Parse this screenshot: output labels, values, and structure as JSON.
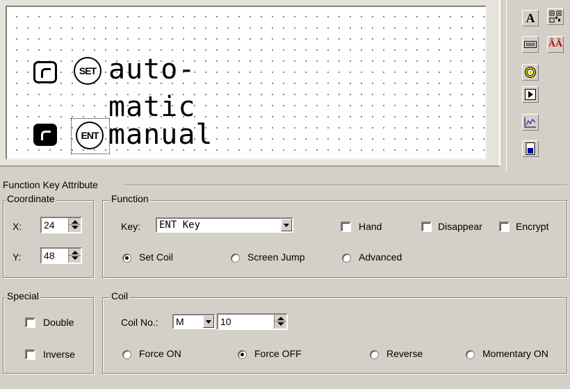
{
  "canvas": {
    "lines": [
      {
        "key_label": "SET",
        "text1": "auto-",
        "text2": "matic"
      },
      {
        "key_label": "ENT",
        "text1": "manual"
      }
    ]
  },
  "toolbox": {
    "icons": [
      "text-tool-icon",
      "qr-tool-icon",
      "bar-tool-icon",
      "font-tool-icon",
      "lamp-tool-icon",
      "play-tool-icon",
      "trend-tool-icon",
      "door-tool-icon"
    ],
    "text_glyph": "A",
    "font_glyph": "ÂÂ"
  },
  "attribute": {
    "title": "Function Key Attribute",
    "coordinate": {
      "title": "Coordinate",
      "x_label": "X:",
      "x_value": "24",
      "y_label": "Y:",
      "y_value": "48"
    },
    "function": {
      "title": "Function",
      "key_label": "Key:",
      "key_value": "ENT Key",
      "hand": "Hand",
      "disappear": "Disappear",
      "encrypt": "Encrypt",
      "set_coil": "Set Coil",
      "screen_jump": "Screen Jump",
      "advanced": "Advanced",
      "selected_mode": "Set Coil"
    },
    "special": {
      "title": "Special",
      "double": "Double",
      "inverse": "Inverse"
    },
    "coil": {
      "title": "Coil",
      "coil_no_label": "Coil No.:",
      "coil_type": "M",
      "coil_number": "10",
      "force_on": "Force ON",
      "force_off": "Force OFF",
      "reverse": "Reverse",
      "momentary_on": "Momentary ON",
      "selected": "Force OFF"
    }
  }
}
